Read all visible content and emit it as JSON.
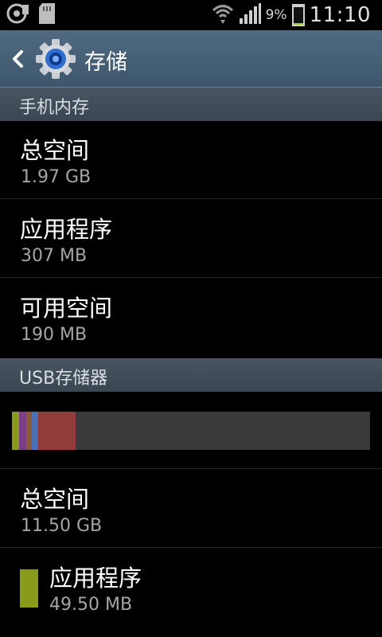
{
  "status_bar": {
    "battery_percent": "9%",
    "battery_level": 0.09,
    "time": "11:10",
    "icons": [
      "usb-debug-icon",
      "sd-card-icon",
      "wifi-icon",
      "signal-icon",
      "battery-icon"
    ]
  },
  "action_bar": {
    "title": "存储",
    "icons": [
      "back-arrow-icon",
      "settings-gear-icon"
    ]
  },
  "internal": {
    "header": "手机内存",
    "rows": [
      {
        "title": "总空间",
        "value": "1.97 GB"
      },
      {
        "title": "应用程序",
        "value": "307 MB"
      },
      {
        "title": "可用空间",
        "value": "190 MB"
      }
    ]
  },
  "usb": {
    "header": "USB存储器",
    "usage_segments": [
      {
        "name": "应用程序",
        "fraction": 0.02,
        "color": "#8a9a1c"
      },
      {
        "name": "segment-2",
        "fraction": 0.02,
        "color": "#7b3f86"
      },
      {
        "name": "segment-3",
        "fraction": 0.015,
        "color": "#8a5a3a"
      },
      {
        "name": "segment-4",
        "fraction": 0.018,
        "color": "#4a6fb5"
      },
      {
        "name": "segment-5",
        "fraction": 0.105,
        "color": "#913b3b"
      }
    ],
    "bar_background": "#3a3a3a",
    "rows": [
      {
        "title": "总空间",
        "value": "11.50 GB"
      },
      {
        "title": "应用程序",
        "value": "49.50 MB",
        "color": "#8a9a1c"
      }
    ]
  }
}
